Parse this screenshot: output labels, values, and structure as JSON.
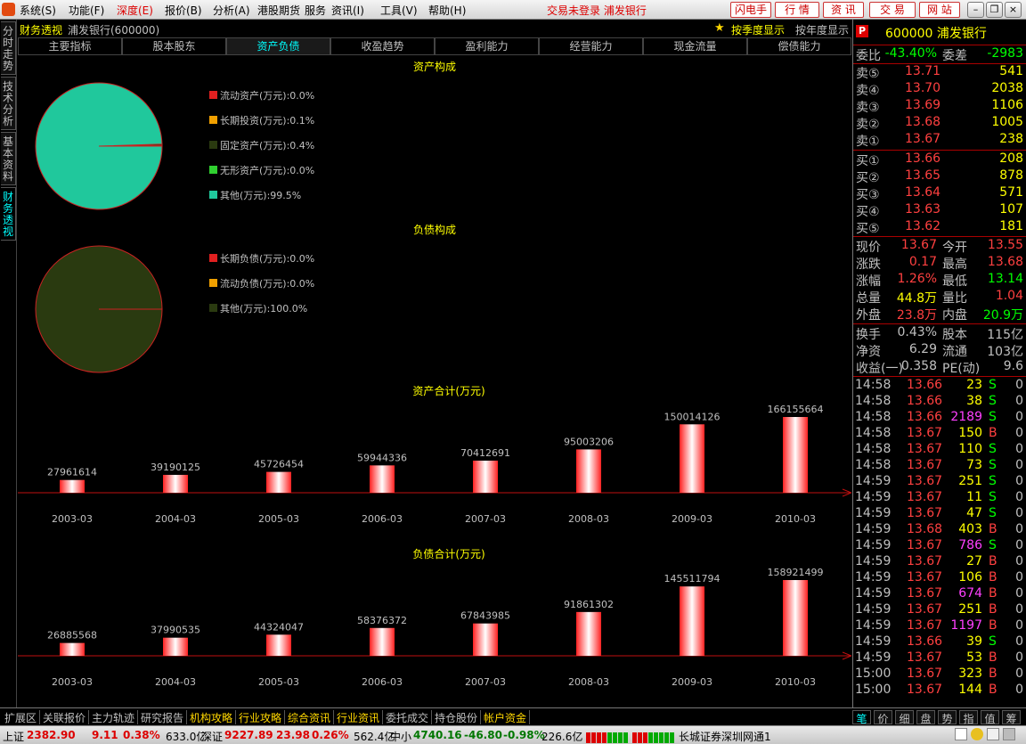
{
  "menu": {
    "items": [
      "系统(S)",
      "功能(F)",
      "深度(E)",
      "报价(B)",
      "分析(A)",
      "港股期货",
      "服务",
      "资讯(I)",
      "工具(V)",
      "帮助(H)"
    ],
    "status": "交易未登录  浦发银行",
    "buttons": [
      "闪电手",
      "行 情",
      "资 讯",
      "交 易",
      "网 站"
    ]
  },
  "vtabs": [
    "分时走势",
    "技术分析",
    "基本资料",
    "财务透视"
  ],
  "title": {
    "label": "财务透视",
    "stock": "浦发银行(600000)",
    "quarter": "按季度显示",
    "year": "按年度显示"
  },
  "tabs": [
    "主要指标",
    "股本股东",
    "资产负债",
    "收盈趋势",
    "盈利能力",
    "经营能力",
    "现金流量",
    "偿债能力"
  ],
  "colors": {
    "bg": "#000000",
    "pie_asset": "#20c89c",
    "pie_liab": "#2a3a10",
    "pie_border": "#cc2222",
    "axis": "#c01010",
    "bar_edge": "#ff3030",
    "bar_mid": "#ffffff"
  },
  "chart_data": [
    {
      "type": "pie",
      "title": "资产构成",
      "slices": [
        {
          "label": "流动资产(万元):0.0%",
          "value": 0.0,
          "color": "#e02020"
        },
        {
          "label": "长期投资(万元):0.1%",
          "value": 0.1,
          "color": "#f0a000"
        },
        {
          "label": "固定资产(万元):0.4%",
          "value": 0.4,
          "color": "#2a3a10"
        },
        {
          "label": "无形资产(万元):0.0%",
          "value": 0.0,
          "color": "#30d030"
        },
        {
          "label": "其他(万元):99.5%",
          "value": 99.5,
          "color": "#20c89c"
        }
      ]
    },
    {
      "type": "pie",
      "title": "负债构成",
      "slices": [
        {
          "label": "长期负债(万元):0.0%",
          "value": 0.0,
          "color": "#e02020"
        },
        {
          "label": "流动负债(万元):0.0%",
          "value": 0.0,
          "color": "#f0a000"
        },
        {
          "label": "其他(万元):100.0%",
          "value": 100.0,
          "color": "#2a3a10"
        }
      ]
    },
    {
      "type": "bar",
      "title": "资产合计(万元)",
      "categories": [
        "2003-03",
        "2004-03",
        "2005-03",
        "2006-03",
        "2007-03",
        "2008-03",
        "2009-03",
        "2010-03"
      ],
      "values": [
        27961614,
        39190125,
        45726454,
        59944336,
        70412691,
        95003206,
        150014126,
        166155664
      ]
    },
    {
      "type": "bar",
      "title": "负债合计(万元)",
      "categories": [
        "2003-03",
        "2004-03",
        "2005-03",
        "2006-03",
        "2007-03",
        "2008-03",
        "2009-03",
        "2010-03"
      ],
      "values": [
        26885568,
        37990535,
        44324047,
        58376372,
        67843985,
        91861302,
        145511794,
        158921499
      ]
    }
  ],
  "quote": {
    "code": "600000 浦发银行",
    "wb_label": "委比",
    "wb": "-43.40%",
    "wc_label": "委差",
    "wc": "-2983",
    "sell": [
      {
        "l": "卖⑤",
        "p": "13.71",
        "v": "541"
      },
      {
        "l": "卖④",
        "p": "13.70",
        "v": "2038"
      },
      {
        "l": "卖③",
        "p": "13.69",
        "v": "1106"
      },
      {
        "l": "卖②",
        "p": "13.68",
        "v": "1005"
      },
      {
        "l": "卖①",
        "p": "13.67",
        "v": "238"
      }
    ],
    "buy": [
      {
        "l": "买①",
        "p": "13.66",
        "v": "208"
      },
      {
        "l": "买②",
        "p": "13.65",
        "v": "878"
      },
      {
        "l": "买③",
        "p": "13.64",
        "v": "571"
      },
      {
        "l": "买④",
        "p": "13.63",
        "v": "107"
      },
      {
        "l": "买⑤",
        "p": "13.62",
        "v": "181"
      }
    ],
    "stats": [
      {
        "a": "现价",
        "av": "13.67",
        "b": "今开",
        "bv": "13.55"
      },
      {
        "a": "涨跌",
        "av": "0.17",
        "b": "最高",
        "bv": "13.68"
      },
      {
        "a": "涨幅",
        "av": "1.26%",
        "b": "最低",
        "bv": "13.14"
      },
      {
        "a": "总量",
        "av": "44.8万",
        "b": "量比",
        "bv": "1.04"
      },
      {
        "a": "外盘",
        "av": "23.8万",
        "b": "内盘",
        "bv": "20.9万"
      }
    ],
    "stats2": [
      {
        "a": "换手",
        "av": "0.43%",
        "b": "股本",
        "bv": "115亿"
      },
      {
        "a": "净资",
        "av": "6.29",
        "b": "流通",
        "bv": "103亿"
      },
      {
        "a": "收益(一)",
        "av": "0.358",
        "b": "PE(动)",
        "bv": "9.6"
      }
    ],
    "ticks": [
      {
        "t": "14:58",
        "p": "13.66",
        "v": "23",
        "s": "S",
        "n": "0"
      },
      {
        "t": "14:58",
        "p": "13.66",
        "v": "38",
        "s": "S",
        "n": "0"
      },
      {
        "t": "14:58",
        "p": "13.66",
        "v": "2189",
        "s": "S",
        "n": "0"
      },
      {
        "t": "14:58",
        "p": "13.67",
        "v": "150",
        "s": "B",
        "n": "0"
      },
      {
        "t": "14:58",
        "p": "13.67",
        "v": "110",
        "s": "S",
        "n": "0"
      },
      {
        "t": "14:58",
        "p": "13.67",
        "v": "73",
        "s": "S",
        "n": "0"
      },
      {
        "t": "14:59",
        "p": "13.67",
        "v": "251",
        "s": "S",
        "n": "0"
      },
      {
        "t": "14:59",
        "p": "13.67",
        "v": "11",
        "s": "S",
        "n": "0"
      },
      {
        "t": "14:59",
        "p": "13.67",
        "v": "47",
        "s": "S",
        "n": "0"
      },
      {
        "t": "14:59",
        "p": "13.68",
        "v": "403",
        "s": "B",
        "n": "0"
      },
      {
        "t": "14:59",
        "p": "13.67",
        "v": "786",
        "s": "S",
        "n": "0"
      },
      {
        "t": "14:59",
        "p": "13.67",
        "v": "27",
        "s": "B",
        "n": "0"
      },
      {
        "t": "14:59",
        "p": "13.67",
        "v": "106",
        "s": "B",
        "n": "0"
      },
      {
        "t": "14:59",
        "p": "13.67",
        "v": "674",
        "s": "B",
        "n": "0"
      },
      {
        "t": "14:59",
        "p": "13.67",
        "v": "251",
        "s": "B",
        "n": "0"
      },
      {
        "t": "14:59",
        "p": "13.67",
        "v": "1197",
        "s": "B",
        "n": "0"
      },
      {
        "t": "14:59",
        "p": "13.66",
        "v": "39",
        "s": "S",
        "n": "0"
      },
      {
        "t": "14:59",
        "p": "13.67",
        "v": "53",
        "s": "B",
        "n": "0"
      },
      {
        "t": "15:00",
        "p": "13.67",
        "v": "323",
        "s": "B",
        "n": "0"
      },
      {
        "t": "15:00",
        "p": "13.67",
        "v": "144",
        "s": "B",
        "n": "0"
      }
    ]
  },
  "bottom_tabs": [
    "扩展区",
    "关联报价",
    "主力轨迹",
    "研究报告",
    "机构攻略",
    "行业攻略",
    "综合资讯",
    "行业资讯",
    "委托成交",
    "持仓股份",
    "帐户资金"
  ],
  "right_tabs": [
    "笔",
    "价",
    "细",
    "盘",
    "势",
    "指",
    "值",
    "筹"
  ],
  "index": {
    "sh_label": "上证",
    "sh": "2382.90",
    "sh_chg": "9.11",
    "sh_pct": "0.38%",
    "sh_amt": "633.0亿",
    "sz_label": "深证",
    "sz": "9227.89",
    "sz_chg": "23.98",
    "sz_pct": "0.26%",
    "sz_amt": "562.4亿",
    "zx_label": "中小",
    "zx": "4740.16",
    "zx_chg": "-46.80",
    "zx_pct": "-0.98%",
    "zx_amt": "226.6亿",
    "broker": "长城证券深圳网通1"
  }
}
